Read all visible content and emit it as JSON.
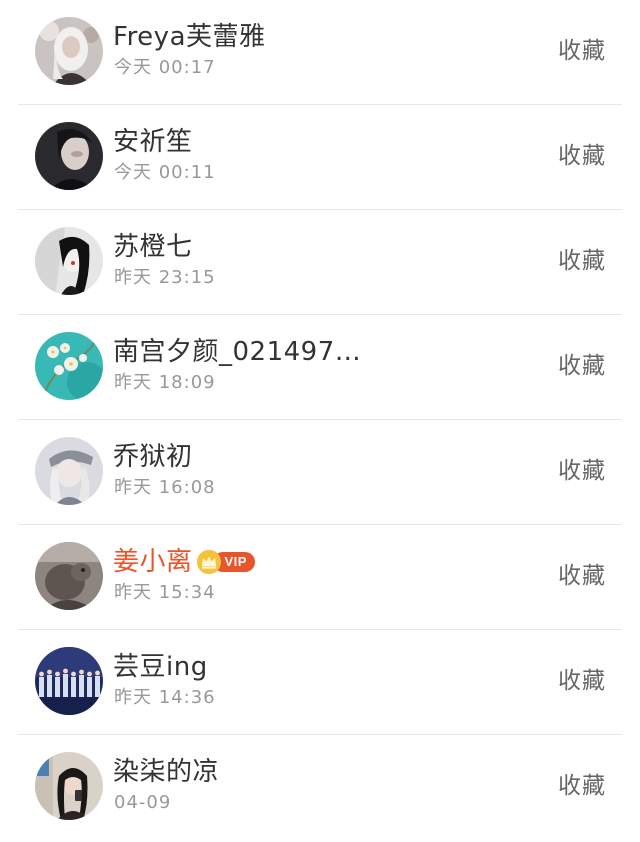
{
  "items": [
    {
      "name": "Freya芙蕾雅",
      "time": "今天 00:17",
      "action": "收藏",
      "vip": false,
      "avatar": "avatar-white-hair-girl"
    },
    {
      "name": "安祈笙",
      "time": "今天 00:11",
      "action": "收藏",
      "vip": false,
      "avatar": "avatar-dark-girl"
    },
    {
      "name": "苏橙七",
      "time": "昨天 23:15",
      "action": "收藏",
      "vip": false,
      "avatar": "avatar-bw-girl"
    },
    {
      "name": "南宫夕颜_021497…",
      "time": "昨天 18:09",
      "action": "收藏",
      "vip": false,
      "avatar": "avatar-orchid-teal"
    },
    {
      "name": "乔狱初",
      "time": "昨天 16:08",
      "action": "收藏",
      "vip": false,
      "avatar": "avatar-cap-girl"
    },
    {
      "name": "姜小离",
      "time": "昨天 15:34",
      "action": "收藏",
      "vip": true,
      "vip_label": "VIP",
      "avatar": "avatar-animal"
    },
    {
      "name": "芸豆ing",
      "time": "昨天 14:36",
      "action": "收藏",
      "vip": false,
      "avatar": "avatar-group-stage"
    },
    {
      "name": "染柒的凉",
      "time": "04-09",
      "action": "收藏",
      "vip": false,
      "avatar": "avatar-selfie-girl"
    }
  ],
  "colors": {
    "vip_name": "#e8552b",
    "vip_badge": "#e8552b",
    "vip_crown": "#f6c23a",
    "divider": "#e6e6e6",
    "time_text": "#999999",
    "action_text": "#666666"
  }
}
